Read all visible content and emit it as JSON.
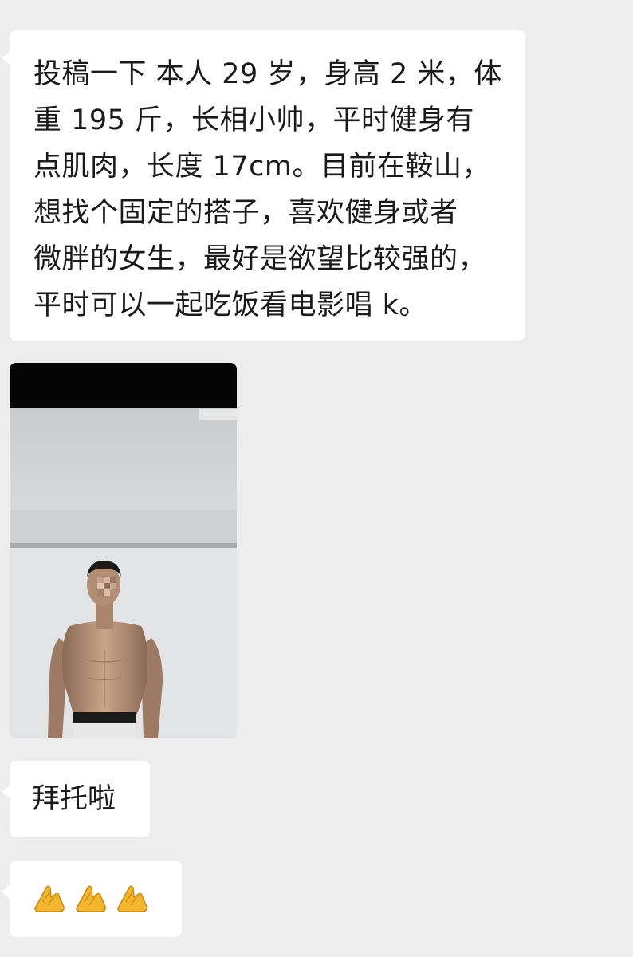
{
  "messages": [
    {
      "type": "text",
      "lines": [
        "投稿一下 本人 29 岁，身高 2 米，体",
        "重 195 斤，长相小帅，平时健身有",
        "点肌肉，长度 17cm。目前在鞍山，",
        "想找个固定的搭子，喜欢健身或者",
        "微胖的女生，最好是欲望比较强的，",
        "平时可以一起吃饭看电影唱 k。"
      ]
    },
    {
      "type": "image",
      "content": "shirtless-man-photo"
    },
    {
      "type": "text",
      "text": "拜托啦"
    },
    {
      "type": "emoji",
      "icons": [
        "folded-hands-icon",
        "folded-hands-icon",
        "folded-hands-icon"
      ]
    }
  ],
  "colors": {
    "background": "#ededed",
    "bubble": "#ffffff",
    "text": "#1a1a1a",
    "emoji": "#f2b52c"
  }
}
